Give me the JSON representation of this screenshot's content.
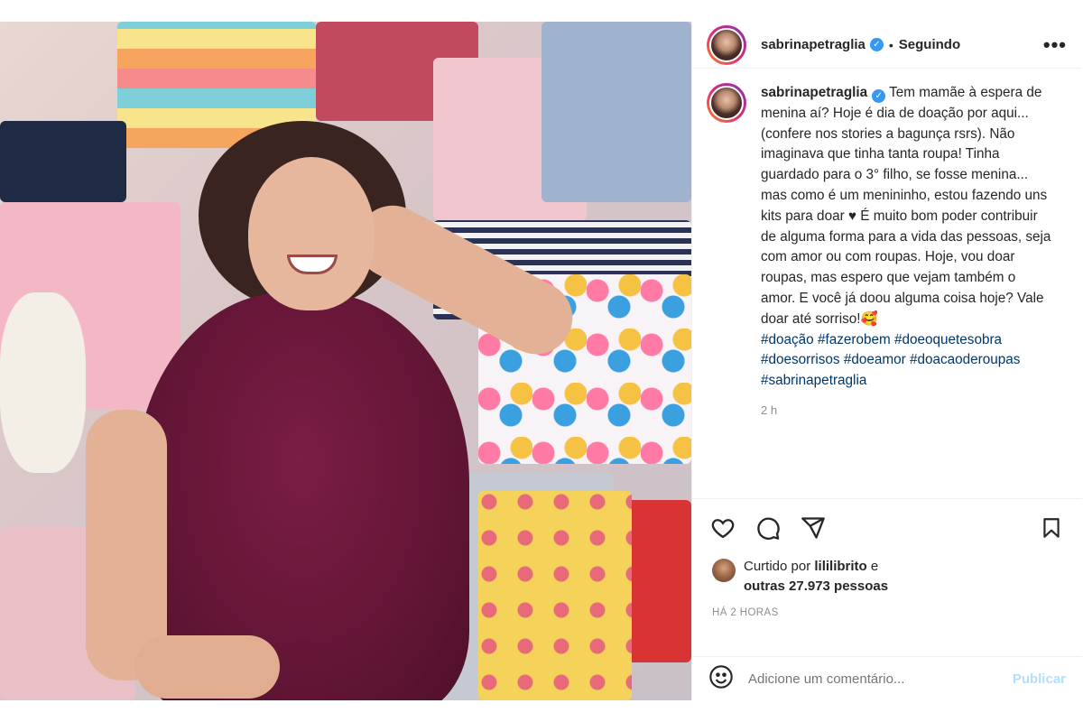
{
  "post": {
    "username": "sabrinapetraglia",
    "separator": "•",
    "follow_status": "Seguindo",
    "more_label": "•••",
    "caption_text_before": "Tem mamãe à espera de menina aí? Hoje é dia de doação por aqui... (confere nos stories a bagunça rsrs). Não imaginava que tinha tanta roupa! Tinha guardado para o 3° filho, se fosse menina... mas como é um menininho, estou fazendo uns kits para doar ♥ É muito bom poder contribuir de alguma forma para a vida das pessoas, seja com amor ou com roupas. Hoje, vou doar roupas, mas espero que vejam também o amor. E você já doou alguma coisa hoje? Vale doar até sorriso!🥰",
    "hashtags": [
      "#doação",
      "#fazerobem",
      "#doeoquetesobra",
      "#doesorrisos",
      "#doeamor",
      "#doacaoderoupas",
      "#sabrinapetraglia"
    ],
    "caption_time": "2 h",
    "liked_by_prefix": "Curtido por",
    "liked_by_user": "lililibrito",
    "liked_by_connector": "e",
    "liked_by_others": "outras 27.973 pessoas",
    "post_age": "HÁ 2 HORAS",
    "comment_placeholder": "Adicione um comentário...",
    "publish_label": "Publicar"
  },
  "icons": {
    "like": "heart-icon",
    "comment": "comment-icon",
    "share": "paper-plane-icon",
    "save": "bookmark-icon",
    "emoji": "emoji-icon",
    "verified": "verified-badge-icon"
  },
  "colors": {
    "verified_blue": "#3897f0",
    "hashtag": "#00376b",
    "publish_disabled": "#b2dffc",
    "muted": "#8e8e8e",
    "dress": "#6a1738"
  }
}
